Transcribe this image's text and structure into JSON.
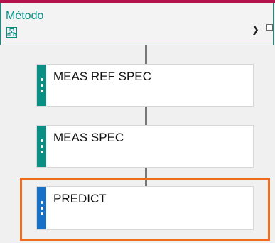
{
  "method": {
    "title": "Método",
    "icon": "method-structure-icon",
    "expand_icon": "chevron-right-icon"
  },
  "steps": [
    {
      "label": "MEAS REF SPEC",
      "color": "#0a8f84",
      "selected": false
    },
    {
      "label": "MEAS SPEC",
      "color": "#0a8f84",
      "selected": false
    },
    {
      "label": "PREDICT",
      "color": "#1772c7",
      "selected": true
    }
  ],
  "colors": {
    "accent_top": "#b3124b",
    "method_border": "#009a8c",
    "highlight": "#f26a1b"
  }
}
